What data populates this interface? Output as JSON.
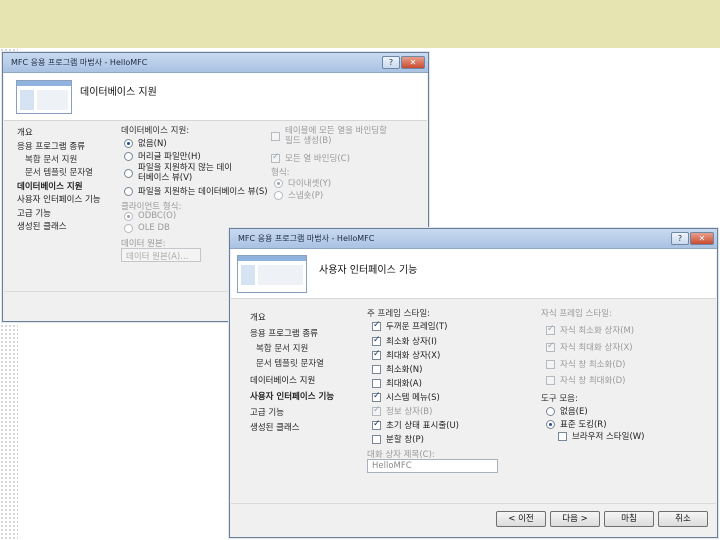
{
  "back_window": {
    "title": "MFC 응용 프로그램 마법사 - HelloMFC",
    "heading": "데이터베이스 지원",
    "nav": [
      "개요",
      "응용 프로그램 종류",
      "복합 문서 지원",
      "문서 템플릿 문자열",
      "데이터베이스 지원",
      "사용자 인터페이스 기능",
      "고급 기능",
      "생성된 클래스"
    ],
    "db_support_label": "데이터베이스 지원:",
    "db_options": [
      "없음(N)",
      "머리글 파일만(H)",
      "파일을 지원하지 않는 데이터베이스 뷰(V)",
      "파일을 지원하는 데이터베이스 뷰(S)"
    ],
    "client_type_label": "클라이언트 형식:",
    "client_options": [
      "ODBC(O)",
      "OLE DB"
    ],
    "data_source_label": "데이터 원본:",
    "data_source_button": "데이터 원본(A)...",
    "generate_columns_label": "테이블에 모든 열을 바인딩할 필드 생성(B)",
    "bind_all_label": "모든 열 바인딩(C)",
    "type_label": "형식:",
    "type_options": [
      "다이내셋(Y)",
      "스냅숏(P)"
    ]
  },
  "front_window": {
    "title": "MFC 응용 프로그램 마법사 - HelloMFC",
    "heading": "사용자 인터페이스 기능",
    "nav": [
      "개요",
      "응용 프로그램 종류",
      "복합 문서 지원",
      "문서 템플릿 문자열",
      "데이터베이스 지원",
      "사용자 인터페이스 기능",
      "고급 기능",
      "생성된 클래스"
    ],
    "main_frame_label": "주 프레임 스타일:",
    "main_frame_options": [
      {
        "label": "두꺼운 프레임(T)",
        "checked": true
      },
      {
        "label": "최소화 상자(I)",
        "checked": true
      },
      {
        "label": "최대화 상자(X)",
        "checked": true
      },
      {
        "label": "최소화(N)",
        "checked": false
      },
      {
        "label": "최대화(A)",
        "checked": false
      },
      {
        "label": "시스템 메뉴(S)",
        "checked": true
      },
      {
        "label": "정보 상자(B)",
        "checked": true
      },
      {
        "label": "초기 상태 표시줄(U)",
        "checked": true
      },
      {
        "label": "분할 창(P)",
        "checked": false
      }
    ],
    "child_frame_label": "자식 프레임 스타일:",
    "child_frame_options": [
      {
        "label": "자식 최소화 상자(M)",
        "checked": true
      },
      {
        "label": "자식 최대화 상자(X)",
        "checked": true
      },
      {
        "label": "자식 창 최소화(D)",
        "checked": false
      },
      {
        "label": "자식 창 최대화(D)",
        "checked": false
      }
    ],
    "toolbar_label": "도구 모음:",
    "toolbar_options": [
      {
        "label": "없음(E)",
        "selected": false
      },
      {
        "label": "표준 도킹(R)",
        "selected": true
      }
    ],
    "browser_style_label": "브라우저 스타일(W)",
    "caption_label": "대화 상자 제목(C):",
    "caption_value": "HelloMFC",
    "buttons": {
      "prev": "< 이전",
      "next": "다음 >",
      "finish": "마침",
      "cancel": "취소"
    }
  }
}
